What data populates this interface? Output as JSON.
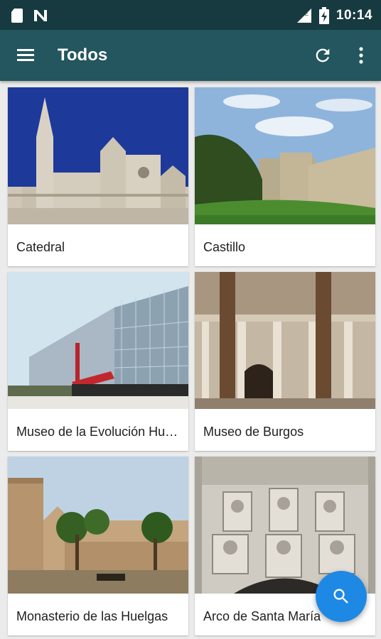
{
  "status_bar": {
    "time": "10:14",
    "icons": [
      "sd-card-icon",
      "n-notification-icon",
      "signal-icon",
      "battery-charging-icon"
    ]
  },
  "app_bar": {
    "title": "Todos",
    "actions": [
      "menu-icon",
      "refresh-icon",
      "more-vert-icon"
    ]
  },
  "cards": [
    {
      "label": "Catedral"
    },
    {
      "label": "Castillo"
    },
    {
      "label": "Museo de la Evolución Humana"
    },
    {
      "label": "Museo de Burgos"
    },
    {
      "label": "Monasterio de las Huelgas"
    },
    {
      "label": "Arco de Santa María"
    }
  ],
  "fab": {
    "icon": "search-icon"
  },
  "colors": {
    "status_bar": "#173a40",
    "app_bar": "#23565e",
    "background": "#ebebeb",
    "fab": "#1e88e5"
  }
}
